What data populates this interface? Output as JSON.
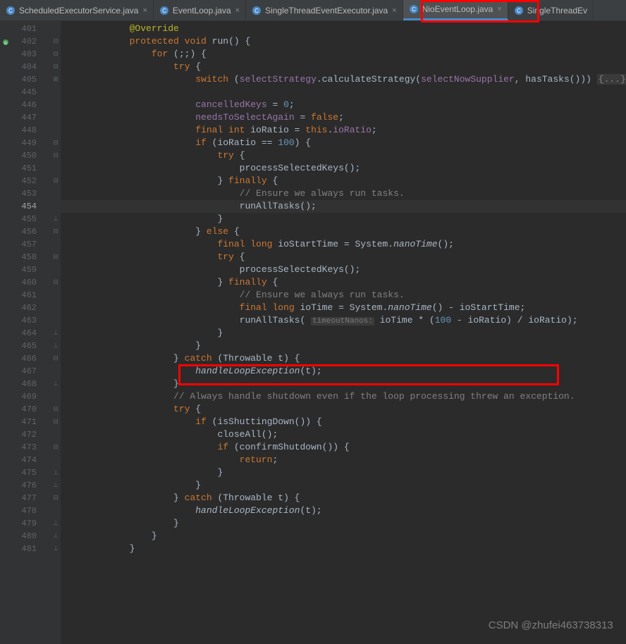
{
  "tabs": [
    {
      "label": "ScheduledExecutorService.java",
      "active": false
    },
    {
      "label": "EventLoop.java",
      "active": false
    },
    {
      "label": "SingleThreadEventExecutor.java",
      "active": false
    },
    {
      "label": "NioEventLoop.java",
      "active": true
    },
    {
      "label": "SingleThreadEv",
      "active": false
    }
  ],
  "lineNumbers": [
    "401",
    "402",
    "403",
    "404",
    "405",
    "445",
    "446",
    "447",
    "448",
    "449",
    "450",
    "451",
    "452",
    "453",
    "454",
    "455",
    "456",
    "457",
    "458",
    "459",
    "460",
    "461",
    "462",
    "463",
    "464",
    "465",
    "466",
    "467",
    "468",
    "469",
    "470",
    "471",
    "472",
    "473",
    "474",
    "475",
    "476",
    "477",
    "478",
    "479",
    "480",
    "481"
  ],
  "currentLine": "454",
  "code": {
    "l401": {
      "indent": "            ",
      "annotation": "@Override"
    },
    "l402": {
      "indent": "            ",
      "kw1": "protected void ",
      "name": "run",
      "rest": "() {"
    },
    "l403": {
      "indent": "                ",
      "kw": "for ",
      "rest": "(;;) {"
    },
    "l404": {
      "indent": "                    ",
      "kw": "try ",
      "rest": "{"
    },
    "l405": {
      "indent": "                        ",
      "kw": "switch ",
      "p1": "(",
      "field1": "selectStrategy",
      "m1": ".calculateStrategy(",
      "field2": "selectNowSupplier",
      "c": ", ",
      "m2": "hasTasks())) ",
      "folded": "{...}"
    },
    "l446": {
      "indent": "                        ",
      "field": "cancelledKeys",
      "rest": " = ",
      "num": "0",
      "semi": ";"
    },
    "l447": {
      "indent": "                        ",
      "field": "needsToSelectAgain",
      "rest": " = ",
      "kw": "false",
      "semi": ";"
    },
    "l448": {
      "indent": "                        ",
      "kw": "final int ",
      "var": "ioRatio = ",
      "kw2": "this",
      "dot": ".",
      "field": "ioRatio",
      "semi": ";"
    },
    "l449": {
      "indent": "                        ",
      "kw": "if ",
      "p1": "(ioRatio == ",
      "num": "100",
      "rest": ") {"
    },
    "l450": {
      "indent": "                            ",
      "kw": "try ",
      "rest": "{"
    },
    "l451": {
      "indent": "                                ",
      "call": "processSelectedKeys();"
    },
    "l452": {
      "indent": "                            ",
      "rest": "} ",
      "kw": "finally ",
      "rest2": "{"
    },
    "l453": {
      "indent": "                                ",
      "comment": "// Ensure we always run tasks."
    },
    "l454": {
      "indent": "                                ",
      "call": "runAllTasks();"
    },
    "l455": {
      "indent": "                            ",
      "rest": "}"
    },
    "l456": {
      "indent": "                        ",
      "rest": "} ",
      "kw": "else ",
      "rest2": "{"
    },
    "l457": {
      "indent": "                            ",
      "kw": "final long ",
      "var": "ioStartTime = System.",
      "static": "nanoTime",
      "rest": "();"
    },
    "l458": {
      "indent": "                            ",
      "kw": "try ",
      "rest": "{"
    },
    "l459": {
      "indent": "                                ",
      "call": "processSelectedKeys();"
    },
    "l460": {
      "indent": "                            ",
      "rest": "} ",
      "kw": "finally ",
      "rest2": "{"
    },
    "l461": {
      "indent": "                                ",
      "comment": "// Ensure we always run tasks."
    },
    "l462": {
      "indent": "                                ",
      "kw": "final long ",
      "var": "ioTime = System.",
      "static": "nanoTime",
      "rest": "() - ioStartTime;"
    },
    "l463": {
      "indent": "                                ",
      "call": "runAllTasks( ",
      "hint": "timeoutNanos:",
      "p1": " ioTime * (",
      "num": "100",
      "p2": " - ioRatio) / ioRatio);"
    },
    "l464": {
      "indent": "                            ",
      "rest": "}"
    },
    "l465": {
      "indent": "                        ",
      "rest": "}"
    },
    "l466": {
      "indent": "                    ",
      "rest": "} ",
      "kw": "catch ",
      "rest2": "(Throwable t) {"
    },
    "l467": {
      "indent": "                        ",
      "static": "handleLoopException",
      "rest": "(t);"
    },
    "l468": {
      "indent": "                    ",
      "rest": "}"
    },
    "l469": {
      "indent": "                    ",
      "comment": "// Always handle shutdown even if the loop processing threw an exception."
    },
    "l470": {
      "indent": "                    ",
      "kw": "try ",
      "rest": "{"
    },
    "l471": {
      "indent": "                        ",
      "kw": "if ",
      "rest": "(isShuttingDown()) {"
    },
    "l472": {
      "indent": "                            ",
      "call": "closeAll();"
    },
    "l473": {
      "indent": "                            ",
      "kw": "if ",
      "rest": "(confirmShutdown()) {"
    },
    "l474": {
      "indent": "                                ",
      "kw": "return",
      "semi": ";"
    },
    "l475": {
      "indent": "                            ",
      "rest": "}"
    },
    "l476": {
      "indent": "                        ",
      "rest": "}"
    },
    "l477": {
      "indent": "                    ",
      "rest": "} ",
      "kw": "catch ",
      "rest2": "(Throwable t) {"
    },
    "l478": {
      "indent": "                        ",
      "static": "handleLoopException",
      "rest": "(t);"
    },
    "l479": {
      "indent": "                    ",
      "rest": "}"
    },
    "l480": {
      "indent": "                ",
      "rest": "}"
    },
    "l481": {
      "indent": "            ",
      "rest": "}"
    }
  },
  "watermark": "CSDN @zhufei463738313"
}
